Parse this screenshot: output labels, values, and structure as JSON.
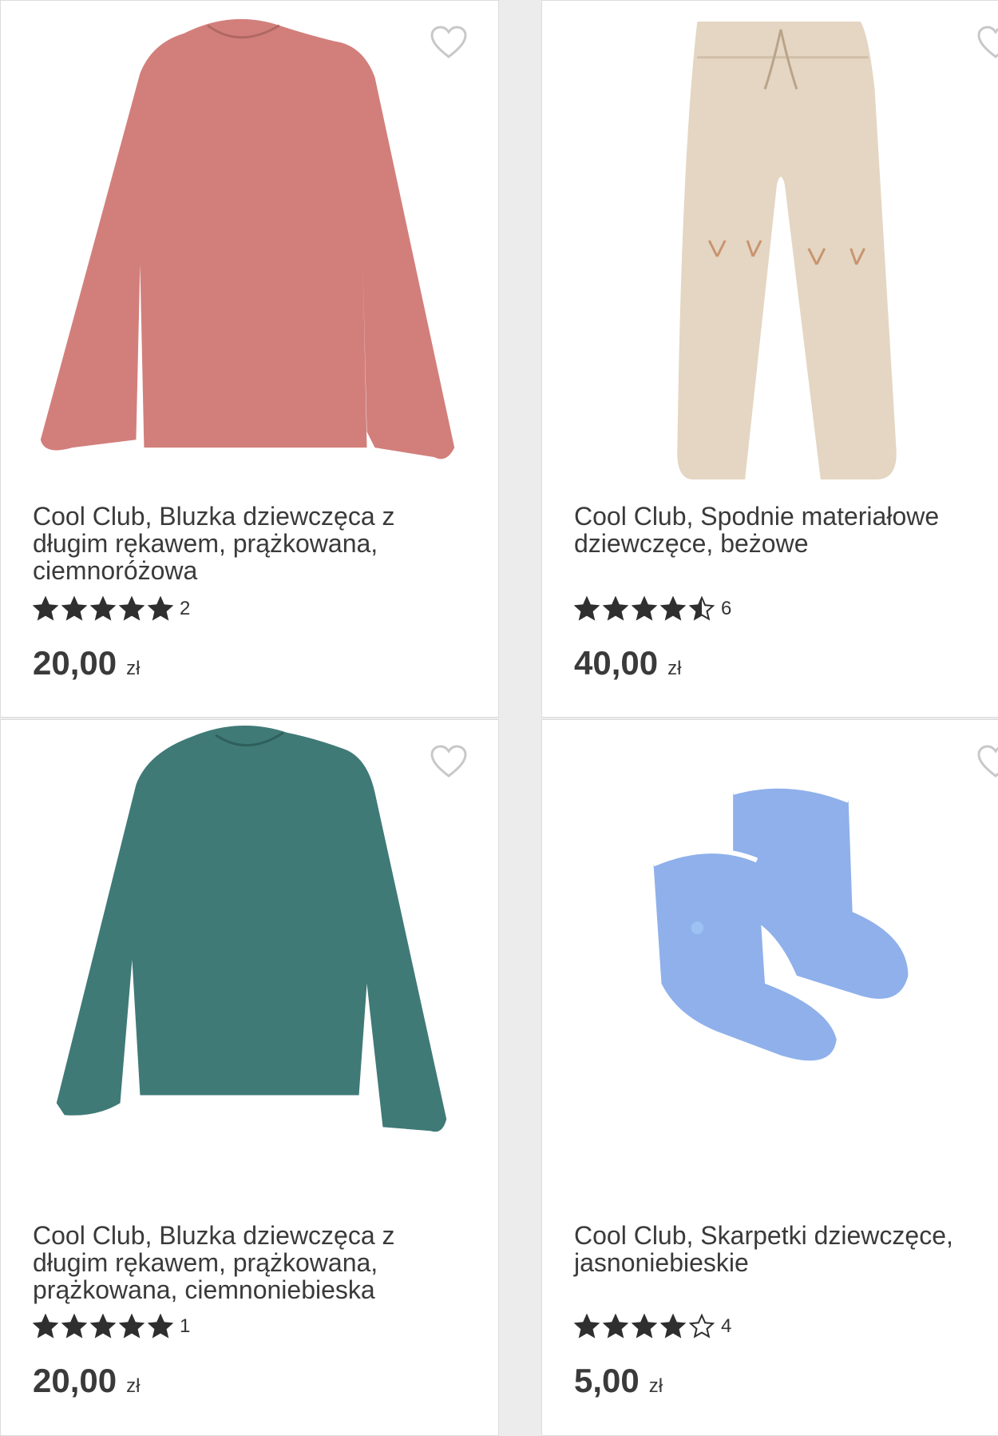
{
  "products": [
    {
      "title": "Cool Club, Bluzka dziewczęca z długim rękawem, prążkowana, ciemnoróżowa",
      "rating": 5,
      "review_count": "2",
      "price": "20,00",
      "currency": "zł",
      "image_icon": "pink-long-sleeve-top",
      "color": "#d27f7c"
    },
    {
      "title": "Cool Club, Spodnie materiałowe dziewczęce, beżowe",
      "rating": 4.5,
      "review_count": "6",
      "price": "40,00",
      "currency": "zł",
      "image_icon": "beige-trousers",
      "color": "#e4d6c2"
    },
    {
      "title": "Cool Club, Bluzka dziewczęca z długim rękawem, prążkowana, prążkowana, ciemnoniebieska",
      "rating": 5,
      "review_count": "1",
      "price": "20,00",
      "currency": "zł",
      "image_icon": "teal-long-sleeve-top",
      "color": "#3f7a77"
    },
    {
      "title": "Cool Club, Skarpetki dziewczęce, jasnoniebieskie",
      "rating": 4,
      "review_count": "4",
      "price": "5,00",
      "currency": "zł",
      "image_icon": "light-blue-baby-socks",
      "color": "#8fb0ea"
    }
  ]
}
